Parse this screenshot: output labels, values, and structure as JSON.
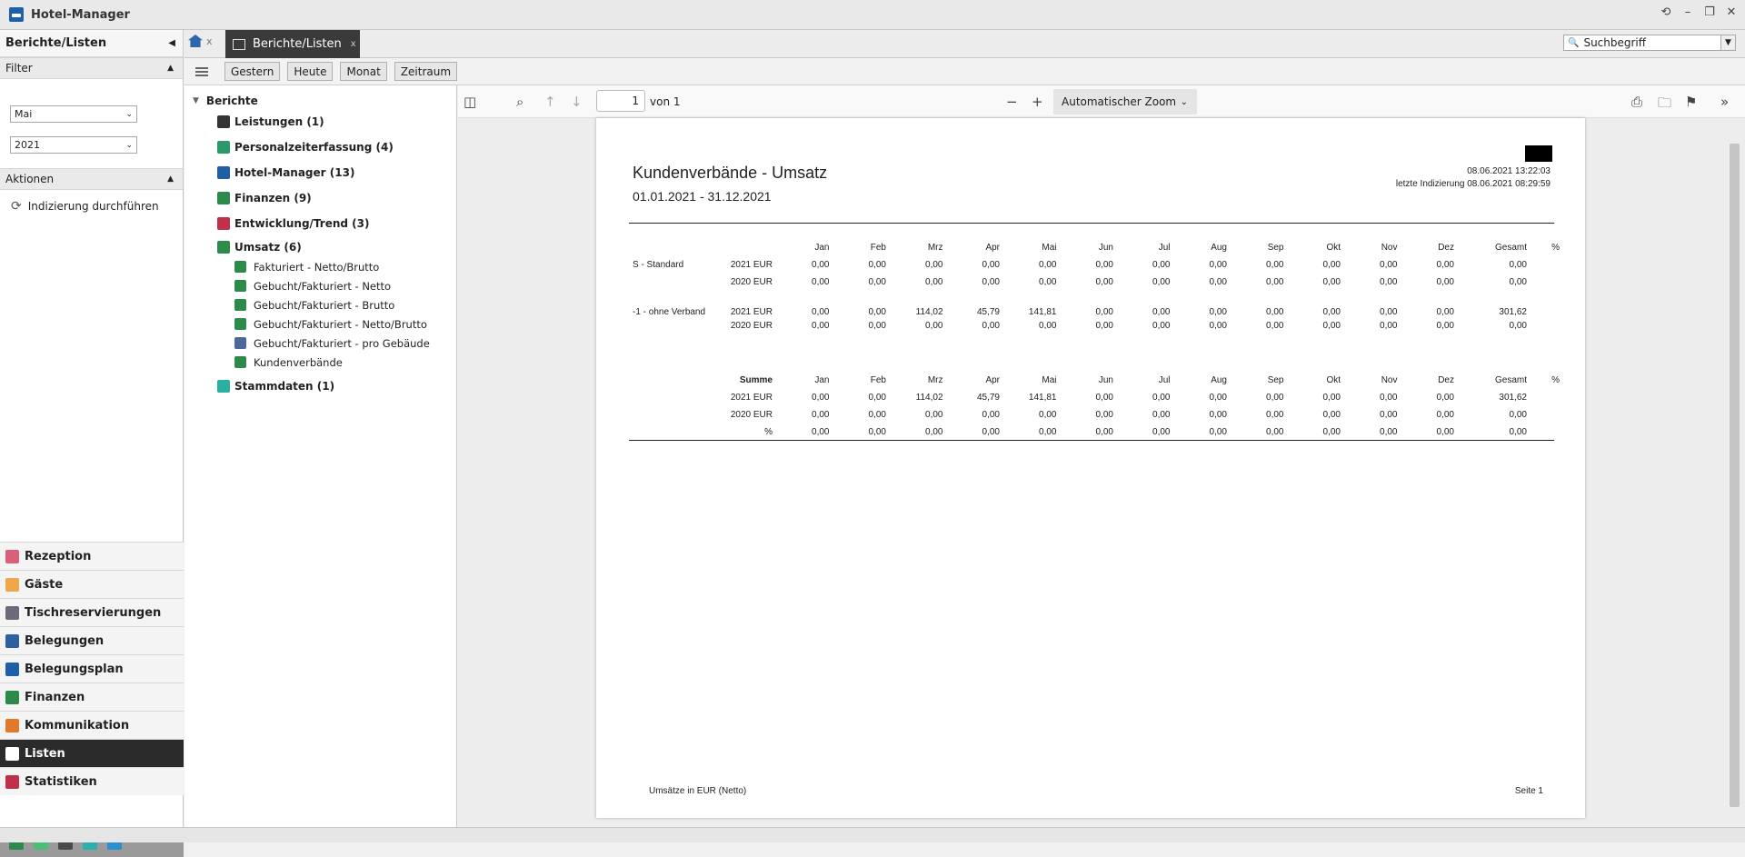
{
  "app": {
    "title": "Hotel-Manager"
  },
  "sidebar": {
    "header": "Berichte/Listen",
    "filter_label": "Filter",
    "month": "Mai",
    "year": "2021",
    "actions_label": "Aktionen",
    "action_reindex": "Indizierung durchführen",
    "nav": [
      {
        "label": "Rezeption",
        "color": "#d9607a"
      },
      {
        "label": "Gäste",
        "color": "#f0a64b"
      },
      {
        "label": "Tischreservierungen",
        "color": "#6a6a7a"
      },
      {
        "label": "Belegungen",
        "color": "#2e5fa0"
      },
      {
        "label": "Belegungsplan",
        "color": "#1f5fa8"
      },
      {
        "label": "Finanzen",
        "color": "#2c8a4a"
      },
      {
        "label": "Kommunikation",
        "color": "#e07a2a"
      },
      {
        "label": "Listen",
        "color": "#ffffff"
      },
      {
        "label": "Statistiken",
        "color": "#c0304a"
      }
    ]
  },
  "tabs": {
    "active": "Berichte/Listen",
    "close": "x",
    "home_close": "x"
  },
  "search": {
    "placeholder": "Suchbegriff"
  },
  "toolbar": {
    "buttons": [
      "Gestern",
      "Heute",
      "Monat",
      "Zeitraum"
    ]
  },
  "tree": {
    "root": "Berichte",
    "nodes": [
      {
        "label": "Leistungen (1)",
        "color": "#333333"
      },
      {
        "label": "Personalzeiterfassung (4)",
        "color": "#2a9a6a"
      },
      {
        "label": "Hotel-Manager (13)",
        "color": "#1f5fa8"
      },
      {
        "label": "Finanzen (9)",
        "color": "#2c8a4a"
      },
      {
        "label": "Entwicklung/Trend (3)",
        "color": "#c0304a"
      },
      {
        "label": "Umsatz (6)",
        "color": "#2c8a4a"
      }
    ],
    "leaves": [
      "Fakturiert - Netto/Brutto",
      "Gebucht/Fakturiert - Netto",
      "Gebucht/Fakturiert - Brutto",
      "Gebucht/Fakturiert - Netto/Brutto",
      "Gebucht/Fakturiert - pro Gebäude",
      "Kundenverbände"
    ],
    "last_node": "Stammdaten (1)"
  },
  "viewer": {
    "page_number": "1",
    "of_label": "von 1",
    "zoom": "Automatischer Zoom"
  },
  "report": {
    "title": "Kundenverbände - Umsatz",
    "range": "01.01.2021 - 31.12.2021",
    "printed": "08.06.2021 13:22:03",
    "indexed": "letzte Indizierung 08.06.2021 08:29:59",
    "months": [
      "Jan",
      "Feb",
      "Mrz",
      "Apr",
      "Mai",
      "Jun",
      "Jul",
      "Aug",
      "Sep",
      "Okt",
      "Nov",
      "Dez"
    ],
    "total_label": "Gesamt",
    "pct_label": "%",
    "sum_label": "Summe",
    "groups": [
      {
        "name": "S - Standard",
        "rows": [
          {
            "year": "2021 EUR",
            "values": [
              "0,00",
              "0,00",
              "0,00",
              "0,00",
              "0,00",
              "0,00",
              "0,00",
              "0,00",
              "0,00",
              "0,00",
              "0,00",
              "0,00"
            ],
            "total": "0,00"
          },
          {
            "year": "2020 EUR",
            "values": [
              "0,00",
              "0,00",
              "0,00",
              "0,00",
              "0,00",
              "0,00",
              "0,00",
              "0,00",
              "0,00",
              "0,00",
              "0,00",
              "0,00"
            ],
            "total": "0,00"
          }
        ]
      },
      {
        "name": "-1 - ohne Verband",
        "rows": [
          {
            "year": "2021 EUR",
            "values": [
              "0,00",
              "0,00",
              "114,02",
              "45,79",
              "141,81",
              "0,00",
              "0,00",
              "0,00",
              "0,00",
              "0,00",
              "0,00",
              "0,00"
            ],
            "total": "301,62"
          },
          {
            "year": "2020 EUR",
            "values": [
              "0,00",
              "0,00",
              "0,00",
              "0,00",
              "0,00",
              "0,00",
              "0,00",
              "0,00",
              "0,00",
              "0,00",
              "0,00",
              "0,00"
            ],
            "total": "0,00"
          }
        ]
      }
    ],
    "summary": [
      {
        "year": "2021 EUR",
        "values": [
          "0,00",
          "0,00",
          "114,02",
          "45,79",
          "141,81",
          "0,00",
          "0,00",
          "0,00",
          "0,00",
          "0,00",
          "0,00",
          "0,00"
        ],
        "total": "301,62"
      },
      {
        "year": "2020 EUR",
        "values": [
          "0,00",
          "0,00",
          "0,00",
          "0,00",
          "0,00",
          "0,00",
          "0,00",
          "0,00",
          "0,00",
          "0,00",
          "0,00",
          "0,00"
        ],
        "total": "0,00"
      },
      {
        "year": "%",
        "values": [
          "0,00",
          "0,00",
          "0,00",
          "0,00",
          "0,00",
          "0,00",
          "0,00",
          "0,00",
          "0,00",
          "0,00",
          "0,00",
          "0,00"
        ],
        "total": "0,00"
      }
    ],
    "footer_left": "Umsätze in EUR (Netto)",
    "footer_right": "Seite 1"
  }
}
